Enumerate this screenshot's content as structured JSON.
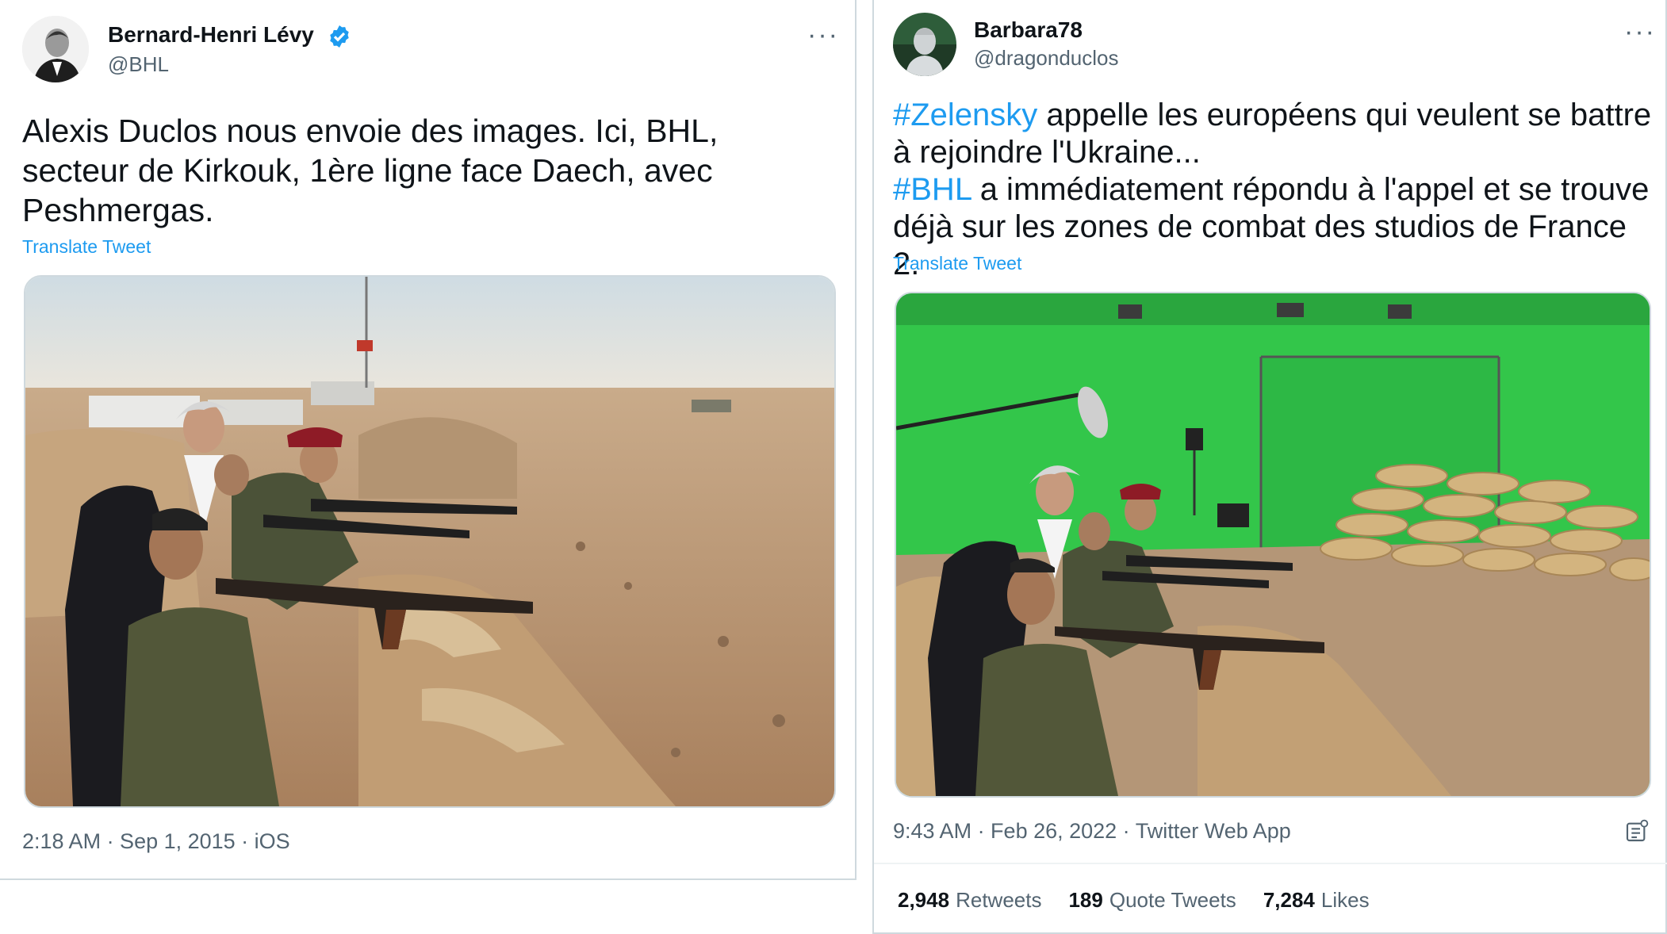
{
  "left": {
    "author_name": "Bernard-Henri Lévy",
    "handle": "@BHL",
    "text_lines": [
      "Alexis Duclos nous envoie des images. Ici, BHL,",
      "secteur de Kirkouk, 1ère ligne face Daech, avec",
      "Peshmergas."
    ],
    "translate": "Translate Tweet",
    "timestamp": "2:18 AM · Sep 1, 2015 · iOS",
    "verified": true,
    "more_icon": "more-horizontal-icon"
  },
  "right": {
    "author_name": "Barbara78",
    "handle": "@dragonduclos",
    "line1": {
      "hashtag": "#Zelensky",
      "rest": " appelle les européens qui veulent se battre"
    },
    "line2": "à rejoindre l'Ukraine...",
    "line3": {
      "hashtag": "#BHL",
      "rest": " a immédiatement répondu à l'appel et se trouve"
    },
    "line4": "déjà sur les zones de combat des studios de France 2.",
    "translate": "Translate Tweet",
    "timestamp": "9:43 AM · Feb 26, 2022 · Twitter Web App",
    "stats": {
      "retweets_count": "2,948",
      "retweets_label": "Retweets",
      "quotes_count": "189",
      "quotes_label": "Quote Tweets",
      "likes_count": "7,284",
      "likes_label": "Likes"
    },
    "more_icon": "more-horizontal-icon"
  },
  "colors": {
    "accent": "#1d9bf0",
    "secondary_text": "#536471",
    "border": "#cfd9de",
    "green_screen": "#2fc54a"
  }
}
